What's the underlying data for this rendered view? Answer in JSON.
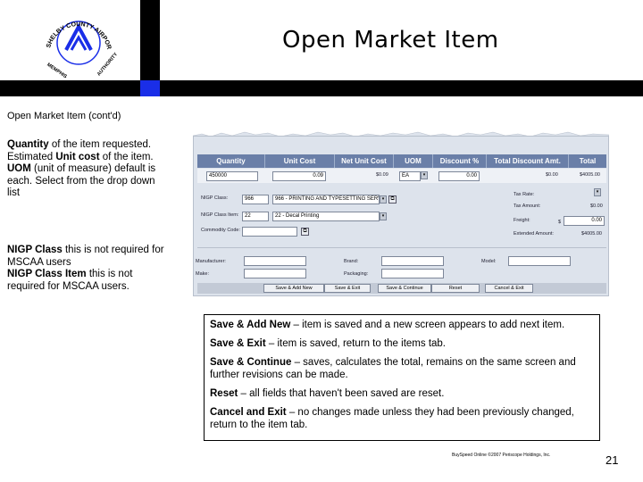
{
  "logo": {
    "text_top": "SHELBY COUNTY AIRPORT",
    "text_side_left": "MEMPHIS",
    "text_side_right": "AUTHORITY"
  },
  "slide": {
    "title": "Open Market Item",
    "subtitle": "Open Market Item (cont'd)",
    "page_number": "21",
    "footer": "BuySpeed Online ©2007 Periscope Holdings, Inc."
  },
  "desc1": {
    "quantity_label": "Quantity",
    "quantity_text": " of the item requested.",
    "unitcost_pre": "Estimated ",
    "unitcost_label": "Unit cost",
    "unitcost_text": " of the item.",
    "uom_label": "UOM",
    "uom_text": " (unit of measure) default is each.  Select from the drop down list"
  },
  "desc2": {
    "nigp_label": "NIGP Class",
    "nigp_text": " this is not required for MSCAA users",
    "nigp_item_label": "NIGP Class Item",
    "nigp_item_text": " this is not required for MSCAA users."
  },
  "form": {
    "columns": [
      "Quantity",
      "Unit Cost",
      "Net Unit Cost",
      "UOM",
      "Discount %",
      "Total Discount Amt.",
      "Total"
    ],
    "quantity_value": "450000",
    "unit_cost_value": "0.09",
    "net_unit_cost_value": "$0.09",
    "uom_value": "EA",
    "discount_value": "0.00",
    "total_discount_value": "$0.00",
    "total_value": "$4005.00",
    "nigp_class_label": "NIGP Class:",
    "nigp_class_code": "966",
    "nigp_class_desc": "966 - PRINTING AND TYPESETTING SERVI...",
    "nigp_item_label": "NIGP Class Item:",
    "nigp_item_code": "22",
    "nigp_item_desc": "22 - Decal Printing",
    "commodity_label": "Commodity Code:",
    "tax_rate_label": "Tax Rate:",
    "tax_amount_label": "Tax Amount:",
    "tax_amount_value": "$0.00",
    "freight_label": "Freight:",
    "freight_currency": "$",
    "freight_value": "0.00",
    "extended_label": "Extended Amount:",
    "extended_value": "$4005.00",
    "manufacturer_label": "Manufacturer:",
    "brand_label": "Brand:",
    "model_label": "Model:",
    "make_label": "Make:",
    "packaging_label": "Packaging:",
    "buttons": [
      "Save & Add New",
      "Save & Exit",
      "Save & Continue",
      "Reset",
      "Cancel & Exit"
    ]
  },
  "explain": {
    "b1_label": "Save & Add New",
    "b1_text": " – item is saved and a new screen appears to add next item.",
    "b2_label": "Save & Exit",
    "b2_text": " – item is saved, return to the items tab.",
    "b3_label": "Save & Continue",
    "b3_text": " – saves, calculates the total, remains on the same screen and further revisions can be made.",
    "b4_label": "Reset",
    "b4_text": " – all fields that haven't been saved are reset.",
    "b5_label": "Cancel and Exit",
    "b5_text": " – no changes made unless they had been previously changed, return to the item tab."
  },
  "colors": {
    "header_blue": "#1a2ee8",
    "table_header": "#6a7fa8"
  }
}
